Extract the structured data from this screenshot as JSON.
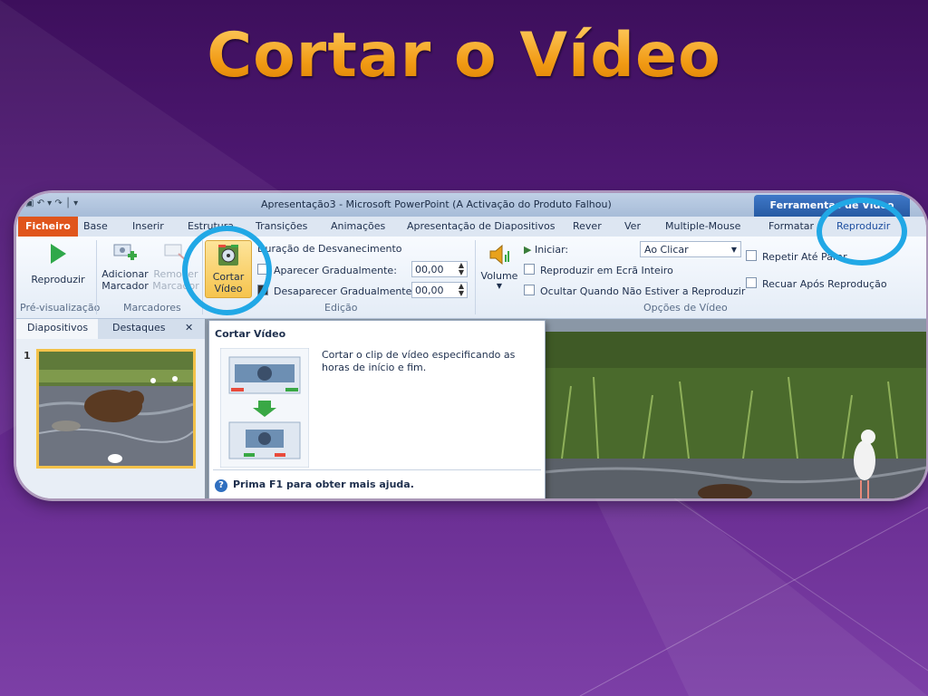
{
  "slide": {
    "title": "Cortar o Vídeo"
  },
  "window": {
    "title": "Apresentação3  -  Microsoft PowerPoint (A Activação do Produto Falhou)",
    "context_tab_header": "Ferramentas de Vídeo"
  },
  "tabs": [
    "Ficheiro",
    "Base",
    "Inserir",
    "Estrutura",
    "Transições",
    "Animações",
    "Apresentação de Diapositivos",
    "Rever",
    "Ver",
    "Multiple-Mouse",
    "Formatar",
    "Reproduzir"
  ],
  "ribbon": {
    "preview": {
      "play_label": "Reproduzir",
      "group_label": "Pré-visualização"
    },
    "markers": {
      "add_label": "Adicionar Marcador",
      "remove_label": "Remover Marcador",
      "group_label": "Marcadores"
    },
    "edit": {
      "trim_label": "Cortar Vídeo",
      "fade_header": "Duração de Desvanecimento",
      "fade_in_label": "Aparecer Gradualmente:",
      "fade_in_value": "00,00",
      "fade_out_label": "Desaparecer Gradualmente:",
      "fade_out_value": "00,00",
      "group_label": "Edição"
    },
    "options": {
      "volume_label": "Volume",
      "start_label": "Iniciar:",
      "start_value": "Ao Clicar",
      "fullscreen_label": "Reproduzir em Ecrã Inteiro",
      "hide_label": "Ocultar Quando Não Estiver a Reproduzir",
      "loop_label": "Repetir Até Parar",
      "rewind_label": "Recuar Após Reprodução",
      "group_label": "Opções de Vídeo"
    }
  },
  "panel": {
    "tab_slides": "Diapositivos",
    "tab_outline": "Destaques",
    "close": "✕",
    "slide_number": "1"
  },
  "tooltip": {
    "title": "Cortar Vídeo",
    "description": "Cortar o clip de vídeo especificando as horas de início e fim.",
    "help": "Prima F1 para obter mais ajuda."
  },
  "colors": {
    "accent_ring": "#21a8e6",
    "title_orange": "#f19a14",
    "file_tab": "#e0551c"
  }
}
